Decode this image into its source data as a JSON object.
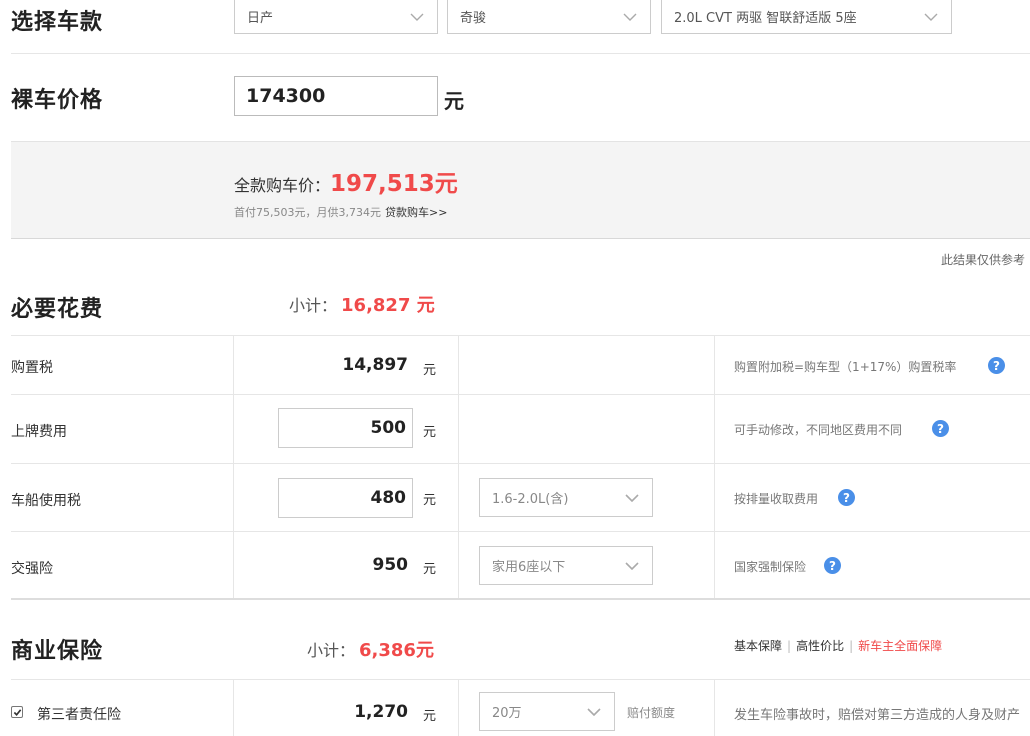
{
  "select_car": {
    "title": "选择车款",
    "brand": "日产",
    "series": "奇骏",
    "model": "2.0L CVT 两驱 智联舒适版 5座"
  },
  "bare_price": {
    "title": "裸车价格",
    "value": "174300",
    "unit": "元"
  },
  "summary": {
    "label": "全款购车价：",
    "value": "197,513元",
    "installment_text": "首付75,503元，月供3,734元",
    "loan_link": "贷款购车>>",
    "disclaimer": "此结果仅供参考"
  },
  "required_costs": {
    "title": "必要花费",
    "subtotal_label": "小计：",
    "subtotal_value": "16,827 元",
    "rows": [
      {
        "label": "购置税",
        "amount": "14,897",
        "unit": "元",
        "note": "购置附加税=购车型（1+17%）购置税率"
      },
      {
        "label": "上牌费用",
        "amount": "500",
        "unit": "元",
        "note": "可手动修改，不同地区费用不同"
      },
      {
        "label": "车船使用税",
        "amount": "480",
        "unit": "元",
        "option": "1.6-2.0L(含)",
        "note": "按排量收取费用"
      },
      {
        "label": "交强险",
        "amount": "950",
        "unit": "元",
        "option": "家用6座以下",
        "note": "国家强制保险"
      }
    ]
  },
  "commercial_insurance": {
    "title": "商业保险",
    "subtotal_label": "小计：",
    "subtotal_value": "6,386元",
    "tabs": [
      "基本保障",
      "高性价比",
      "新车主全面保障"
    ],
    "rows": [
      {
        "label": "第三者责任险",
        "amount": "1,270",
        "unit": "元",
        "option": "20万",
        "option_suffix": "赔付额度",
        "note": "发生车险事故时，赔偿对第三方造成的人身及财产"
      }
    ]
  },
  "icons": {
    "help": "question-circle-icon",
    "dropdown": "chevron-down-icon",
    "check": "checkbox-checked-icon"
  },
  "colors": {
    "accent_red": "#f04a4a",
    "help_blue": "#4a8fe8"
  }
}
